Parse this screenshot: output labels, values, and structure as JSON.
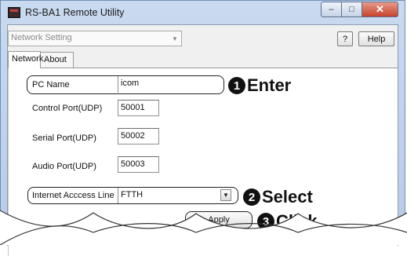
{
  "window": {
    "title": "RS-BA1 Remote Utility",
    "min_glyph": "–",
    "max_glyph": "□",
    "close_glyph": "✕"
  },
  "toolbar": {
    "mode_value": "Network Setting",
    "mode_arrow": "▼",
    "question_label": "?",
    "help_label": "Help"
  },
  "tabs": [
    {
      "label": "Network",
      "active": true
    },
    {
      "label": "About",
      "active": false
    }
  ],
  "form": {
    "pc_name_label": "PC Name",
    "pc_name_value": "icom",
    "control_port_label": "Control Port(UDP)",
    "control_port_value": "50001",
    "serial_port_label": "Serial Port(UDP)",
    "serial_port_value": "50002",
    "audio_port_label": "Audio Port(UDP)",
    "audio_port_value": "50003",
    "internet_line_label": "Internet Acccess Line",
    "internet_line_value": "FTTH",
    "internet_line_arrow": "▼",
    "apply_label": "Apply"
  },
  "callouts": [
    {
      "number": "1",
      "text": "Enter"
    },
    {
      "number": "2",
      "text": "Select"
    },
    {
      "number": "3",
      "text": "Click"
    }
  ]
}
